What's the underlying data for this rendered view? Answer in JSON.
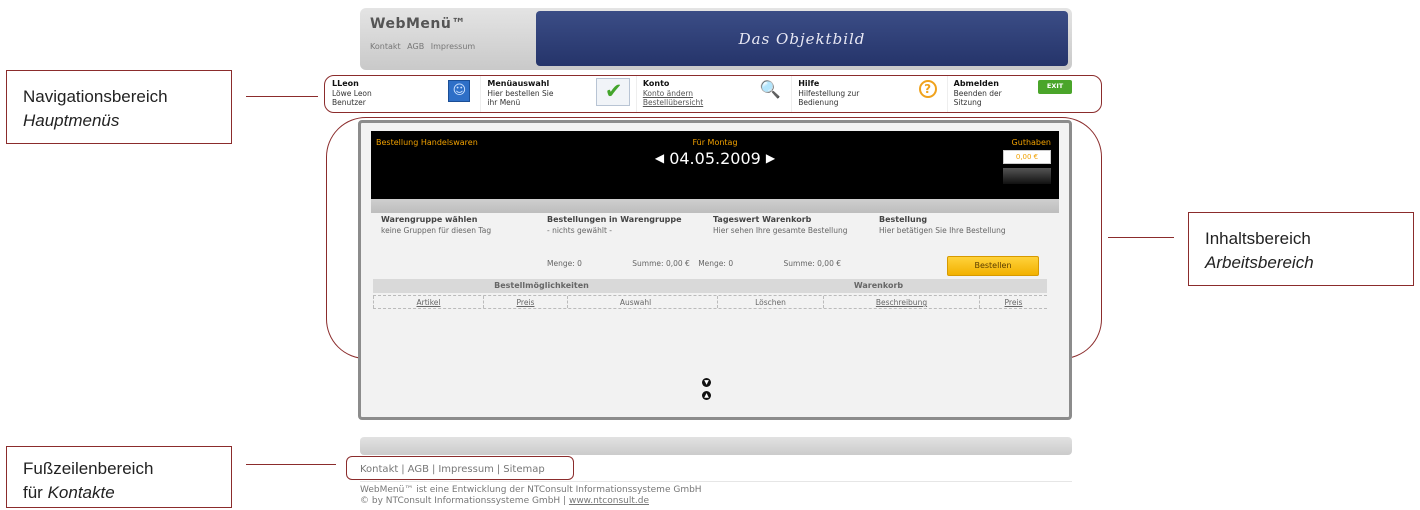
{
  "header": {
    "brand": "WebMenü™",
    "links": [
      "Kontakt",
      "AGB",
      "Impressum"
    ],
    "banner_text": "Das Objektbild"
  },
  "nav": [
    {
      "title": "LLeon",
      "line1": "Löwe Leon",
      "line2": "Benutzer",
      "icon": "smiley-icon"
    },
    {
      "title": "Menüauswahl",
      "line1": "Hier bestellen Sie",
      "line2": "ihr Menü",
      "icon": "checklist-icon"
    },
    {
      "title": "Konto",
      "line1": "Konto ändern",
      "line2": "Bestellübersicht",
      "icon": "magnifier-icon"
    },
    {
      "title": "Hilfe",
      "line1": "Hilfestellung zur",
      "line2": "Bedienung",
      "icon": "help-icon"
    },
    {
      "title": "Abmelden",
      "line1": "Beenden der",
      "line2": "Sitzung",
      "icon": "exit-icon",
      "icon_label": "EXIT"
    }
  ],
  "content": {
    "order_title": "Bestellung Handelswaren",
    "day_label": "Für Montag",
    "date": "04.05.2009",
    "credit_label": "Guthaben",
    "credit_value": "0,00 €",
    "columns": [
      {
        "title": "Warengruppe wählen",
        "text": "keine Gruppen für diesen Tag"
      },
      {
        "title": "Bestellungen in Warengruppe",
        "text": "- nichts gewählt -"
      },
      {
        "title": "Tageswert Warenkorb",
        "text": "Hier sehen Ihre gesamte Bestellung"
      },
      {
        "title": "Bestellung",
        "text": "Hier betätigen Sie Ihre Bestellung"
      }
    ],
    "sum1": "Menge: 0",
    "sum2": "Summe: 0,00 €",
    "sum3": "Menge: 0",
    "sum4": "Summe: 0,00 €",
    "order_button": "Bestellen",
    "table_sections": [
      "Bestellmöglichkeiten",
      "Warenkorb"
    ],
    "table_columns": [
      "Artikel",
      "Preis",
      "Auswahl",
      "Löschen",
      "Beschreibung",
      "Preis"
    ]
  },
  "footer": {
    "links": [
      "Kontakt",
      "AGB",
      "Impressum",
      "Sitemap"
    ],
    "credit_line1": "WebMenü™ ist eine Entwicklung der NTConsult Informationssysteme GmbH",
    "credit_line2": "© by NTConsult Informationssysteme GmbH |",
    "credit_link": "www.ntconsult.de"
  },
  "callouts": {
    "nav_title": "Navigationsbereich",
    "nav_sub": "Hauptmenüs",
    "content_title": "Inhaltsbereich",
    "content_sub": "Arbeitsbereich",
    "footer_title": "Fußzeilenbereich",
    "footer_prefix": "für",
    "footer_sub": "Kontakte"
  },
  "colors": {
    "accent": "#8b2c2c",
    "highlight": "#f0a000",
    "banner": "#2f3f7a"
  }
}
